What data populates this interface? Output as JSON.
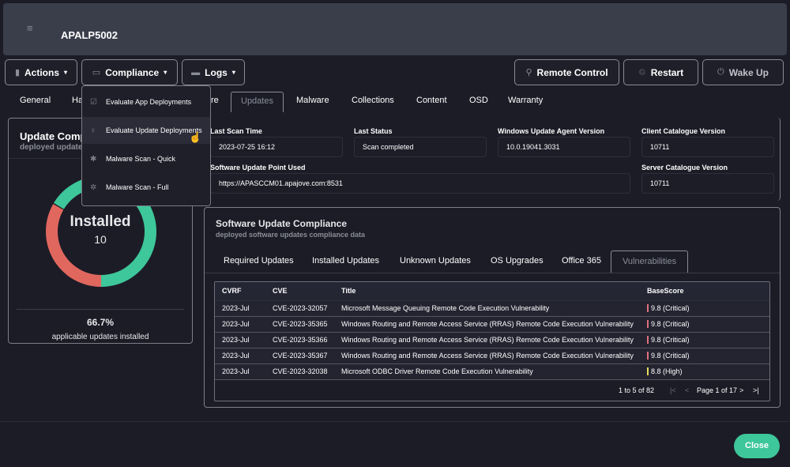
{
  "header": {
    "menu_icon": "hamburger-icon",
    "title": "APALP5002"
  },
  "toolbar": {
    "actions": "Actions",
    "compliance": "Compliance",
    "logs": "Logs",
    "remote_control": "Remote Control",
    "restart": "Restart",
    "wake_up": "Wake Up"
  },
  "compliance_menu": [
    {
      "label": "Evaluate App Deployments",
      "icon": "checkbox-icon"
    },
    {
      "label": "Evaluate Update Deployments",
      "icon": "lightbulb-icon"
    },
    {
      "label": "Malware Scan - Quick",
      "icon": "bug-icon"
    },
    {
      "label": "Malware Scan - Full",
      "icon": "bug-outline-icon"
    }
  ],
  "tabs": [
    "General",
    "Ha",
    "re",
    "Updates",
    "Malware",
    "Collections",
    "Content",
    "OSD",
    "Warranty"
  ],
  "active_tab": "Updates",
  "compliance_card": {
    "title": "Update Comp",
    "subtitle": "deployed update",
    "center_label": "Installed",
    "center_value": "10",
    "percent": "66.7%",
    "caption": "applicable updates installed",
    "installed_fraction": 0.667,
    "colors": {
      "installed": "#3ec79a",
      "missing": "#e0675e"
    }
  },
  "scan_info": {
    "last_scan_time_label": "Last Scan Time",
    "last_scan_time": "2023-07-25 16:12",
    "last_status_label": "Last Status",
    "last_status": "Scan completed",
    "agent_version_label": "Windows Update Agent Version",
    "agent_version": "10.0.19041.3031",
    "client_catalogue_label": "Client Catalogue Version",
    "client_catalogue": "10711",
    "sup_label": "Software Update Point Used",
    "sup": "https://APASCCM01.apajove.com:8531",
    "server_catalogue_label": "Server Catalogue Version",
    "server_catalogue": "10711"
  },
  "sw_compliance": {
    "title": "Software Update Compliance",
    "subtitle": "deployed software updates compliance data",
    "tabs": [
      "Required Updates",
      "Installed Updates",
      "Unknown Updates",
      "OS Upgrades",
      "Office 365",
      "Vulnerabilities"
    ],
    "active_tab": "Vulnerabilities",
    "columns": [
      "CVRF",
      "CVE",
      "Title",
      "BaseScore"
    ],
    "rows": [
      [
        "2023-Jul",
        "CVE-2023-32057",
        "Microsoft Message Queuing Remote Code Execution Vulnerability",
        "9.8 (Critical)"
      ],
      [
        "2023-Jul",
        "CVE-2023-35365",
        "Windows Routing and Remote Access Service (RRAS) Remote Code Execution Vulnerability",
        "9.8 (Critical)"
      ],
      [
        "2023-Jul",
        "CVE-2023-35366",
        "Windows Routing and Remote Access Service (RRAS) Remote Code Execution Vulnerability",
        "9.8 (Critical)"
      ],
      [
        "2023-Jul",
        "CVE-2023-35367",
        "Windows Routing and Remote Access Service (RRAS) Remote Code Execution Vulnerability",
        "9.8 (Critical)"
      ],
      [
        "2023-Jul",
        "CVE-2023-32038",
        "Microsoft ODBC Driver Remote Code Execution Vulnerability",
        "8.8 (High)"
      ]
    ],
    "pager": {
      "range": "1 to 5 of 82",
      "page": "Page 1 of 17"
    }
  },
  "footer": {
    "close": "Close"
  }
}
